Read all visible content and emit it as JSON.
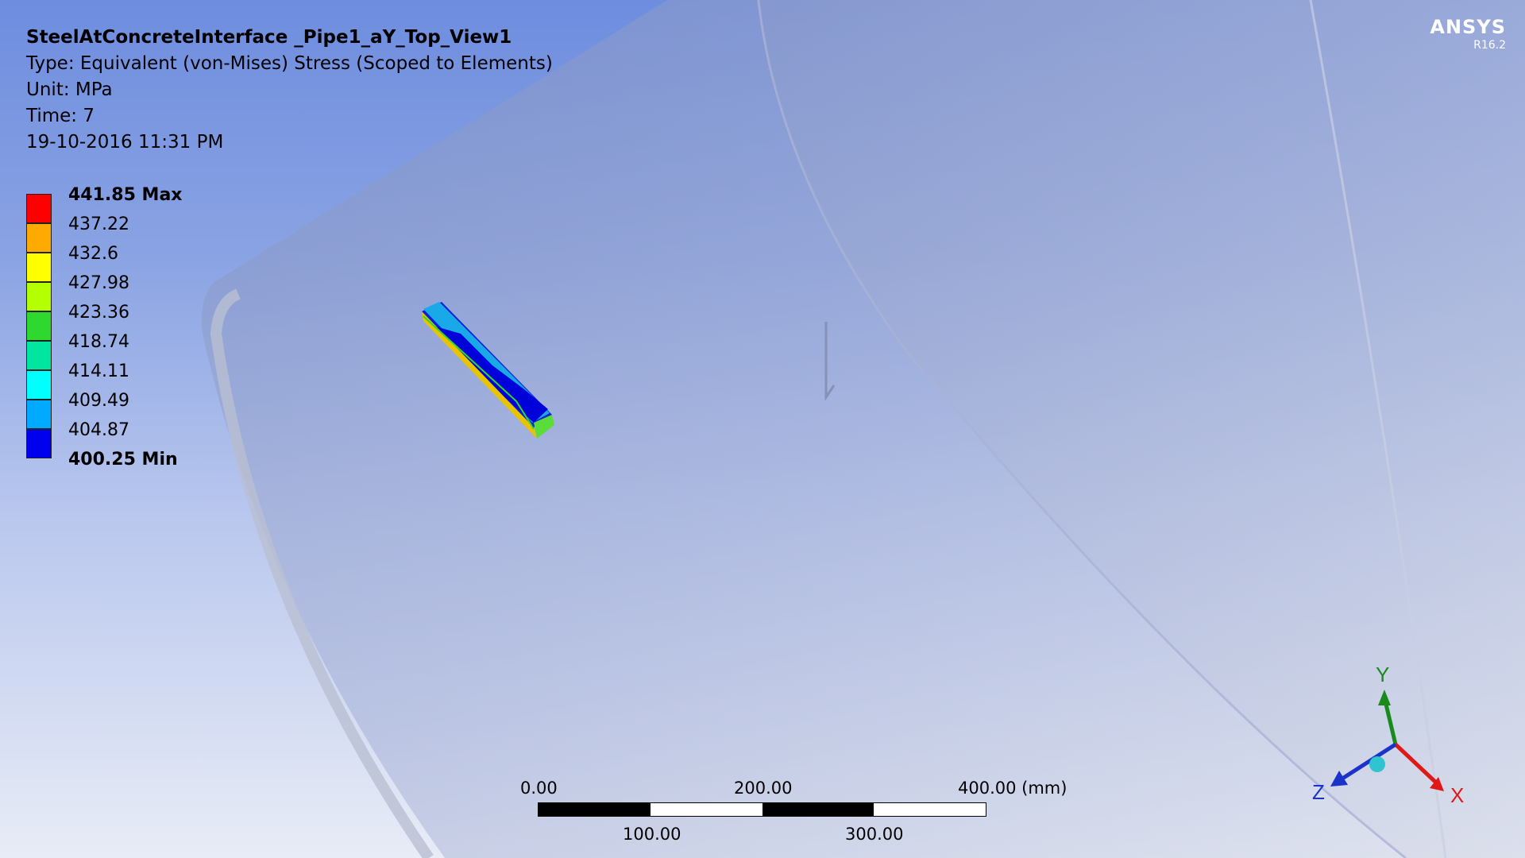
{
  "header": {
    "title": "SteelAtConcreteInterface _Pipe1_aY_Top_View1",
    "type": "Type: Equivalent (von-Mises) Stress (Scoped to Elements)",
    "unit": "Unit: MPa",
    "time": "Time: 7",
    "datetime": "19-10-2016 11:31 PM"
  },
  "brand": {
    "name": "ANSYS",
    "version": "R16.2"
  },
  "legend": {
    "max_label": "441.85 Max",
    "min_label": "400.25 Min",
    "labels": [
      "441.85 Max",
      "437.22",
      "432.6",
      "427.98",
      "423.36",
      "418.74",
      "414.11",
      "409.49",
      "404.87",
      "400.25 Min"
    ],
    "colors": [
      "#ff0000",
      "#ffaa00",
      "#ffff00",
      "#b4ff00",
      "#2ed82e",
      "#00e59f",
      "#00ffff",
      "#00aaff",
      "#0000ee"
    ]
  },
  "scale_bar": {
    "top_labels": [
      "0.00",
      "200.00",
      "400.00 (mm)"
    ],
    "bottom_labels": [
      "100.00",
      "300.00"
    ]
  },
  "triad": {
    "x_label": "X",
    "y_label": "Y",
    "z_label": "Z",
    "x_color": "#e01818",
    "y_color": "#1a8a1a",
    "z_color": "#1a33c8"
  }
}
